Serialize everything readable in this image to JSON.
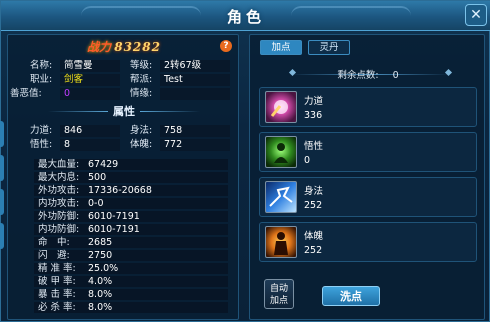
{
  "window": {
    "title": "角色",
    "close_glyph": "✕"
  },
  "left": {
    "power_label": "战力",
    "power_value": "83282",
    "help_glyph": "?",
    "info": {
      "name_label": "名称:",
      "name": "简雪曼",
      "level_label": "等级:",
      "level": "2转67级",
      "job_label": "职业:",
      "job": "剑客",
      "faction_label": "帮派:",
      "faction": "Test",
      "morality_label": "善恶值:",
      "morality": "0",
      "mood_label": "情缘:",
      "mood": ""
    },
    "attr_title": "属性",
    "attrs": {
      "power_label": "力道:",
      "power": "846",
      "agility_label": "身法:",
      "agility": "758",
      "insight_label": "悟性:",
      "insight": "8",
      "physique_label": "体魄:",
      "physique": "772"
    },
    "stats": [
      {
        "label": "最大血量:",
        "value": "67429"
      },
      {
        "label": "最大内息:",
        "value": "500"
      },
      {
        "label": "外功攻击:",
        "value": "17336-20668"
      },
      {
        "label": "内功攻击:",
        "value": "0-0"
      },
      {
        "label": "外功防御:",
        "value": "6010-7191"
      },
      {
        "label": "内功防御:",
        "value": "6010-7191"
      },
      {
        "label": "命　中:",
        "value": "2685"
      },
      {
        "label": "闪　避:",
        "value": "2750"
      },
      {
        "label": "精 准 率:",
        "value": "25.0%"
      },
      {
        "label": "破 甲 率:",
        "value": "4.0%"
      },
      {
        "label": "暴 击 率:",
        "value": "8.0%"
      },
      {
        "label": "必 杀 率:",
        "value": "8.0%"
      }
    ]
  },
  "right": {
    "tabs": [
      {
        "label": "加点",
        "active": true
      },
      {
        "label": "灵丹",
        "active": false
      }
    ],
    "remaining_label": "剩余点数:",
    "remaining_value": "0",
    "cards": [
      {
        "name": "力道",
        "value": "336",
        "icon": "fist-power-icon"
      },
      {
        "name": "悟性",
        "value": "0",
        "icon": "meditation-icon"
      },
      {
        "name": "身法",
        "value": "252",
        "icon": "dash-agility-icon"
      },
      {
        "name": "体魄",
        "value": "252",
        "icon": "body-physique-icon"
      }
    ],
    "auto_label_1": "自动",
    "auto_label_2": "加点",
    "wash_label": "洗点"
  },
  "colors": {
    "accent": "#2e87c0",
    "job": "#f2e21a",
    "morality": "#c23cff",
    "power_text": "#ff5a2a"
  }
}
